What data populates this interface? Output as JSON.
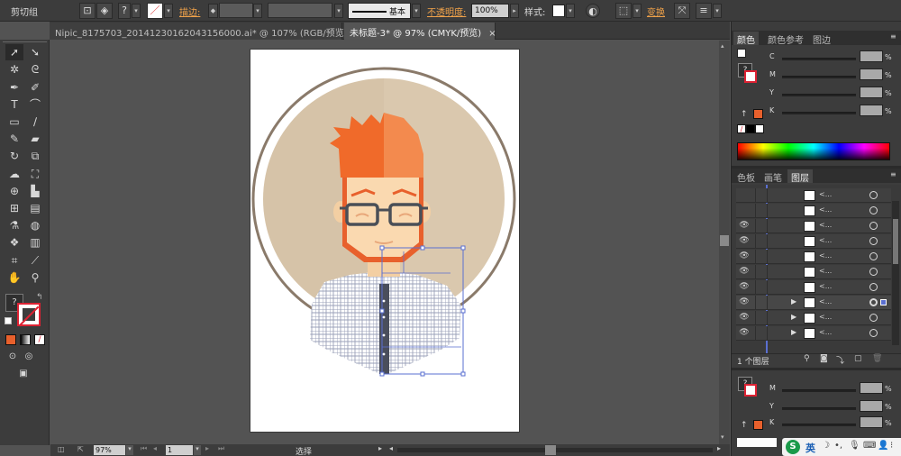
{
  "control_bar": {
    "group_label": "剪切组",
    "stroke_label": "描边:",
    "stroke_style": "基本",
    "opacity_label": "不透明度:",
    "opacity_value": "100%",
    "style_label": "样式:",
    "transform_label": "变换",
    "question_mark": "?"
  },
  "document_tabs": [
    {
      "title": "Nipic_8175703_20141230162043156000.ai* @ 107% (RGB/预览)",
      "close": "×"
    },
    {
      "title": "未标题-3* @ 97% (CMYK/预览)",
      "close": "×"
    }
  ],
  "panels": {
    "color_tabs": [
      "颜色",
      "颜色参考",
      "图边"
    ],
    "cmyk_labels": [
      "C",
      "M",
      "Y",
      "K"
    ],
    "pct": "%",
    "layers_tabs": [
      "色板",
      "画笔",
      "图层"
    ],
    "layers_count": "1 个图层",
    "layer_name": "<...",
    "mini_color_labels": [
      "M",
      "Y",
      "K"
    ]
  },
  "status": {
    "zoom": "97%",
    "page": "1",
    "tool": "选择"
  },
  "ime": {
    "lang": "英"
  },
  "colors": {
    "accent_orange": "#e8602c",
    "hair_orange": "#f06a2a",
    "badge_bg": "#d6c3a8",
    "skin": "#fad9b0",
    "glasses": "#4a4f57",
    "shirt_grid": "#9aa0b8",
    "placket": "#4a4e5c",
    "selection": "#5a6fd0",
    "ring": "#8a7a6a"
  }
}
